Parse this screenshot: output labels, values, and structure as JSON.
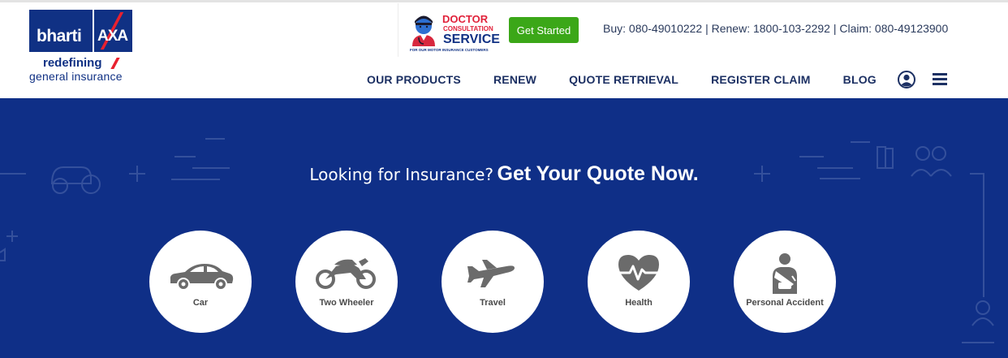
{
  "brand": {
    "name_left": "bharti",
    "name_right": "AXA",
    "tagline_1": "redefining",
    "tagline_2": "general insurance",
    "primary_color": "#103184",
    "accent_color": "#e8212f"
  },
  "promo_badge": {
    "line1": "DOCTOR",
    "line2": "CONSULTATION",
    "line3": "SERVICE",
    "line4": "FOR OUR MOTOR INSURANCE CUSTOMERS",
    "icon": "doctor-avatar-icon"
  },
  "header": {
    "cta_label": "Get Started",
    "cta_color": "#3ba718",
    "contact_line": "Buy: 080-49010222 | Renew: 1800-103-2292 | Claim: 080-49123900"
  },
  "nav": {
    "items": [
      "OUR PRODUCTS",
      "RENEW",
      "QUOTE RETRIEVAL",
      "REGISTER CLAIM",
      "BLOG"
    ],
    "user_icon": "user-account-icon",
    "menu_icon": "hamburger-menu-icon"
  },
  "hero": {
    "background_color": "#0f2f87",
    "title_lead": "Looking for Insurance?",
    "title_strong": "Get Your Quote Now.",
    "products": [
      {
        "label": "Car",
        "icon": "car-icon"
      },
      {
        "label": "Two Wheeler",
        "icon": "motorcycle-icon"
      },
      {
        "label": "Travel",
        "icon": "airplane-icon"
      },
      {
        "label": "Health",
        "icon": "heart-pulse-icon"
      },
      {
        "label": "Personal Accident",
        "icon": "injured-person-icon"
      }
    ]
  }
}
